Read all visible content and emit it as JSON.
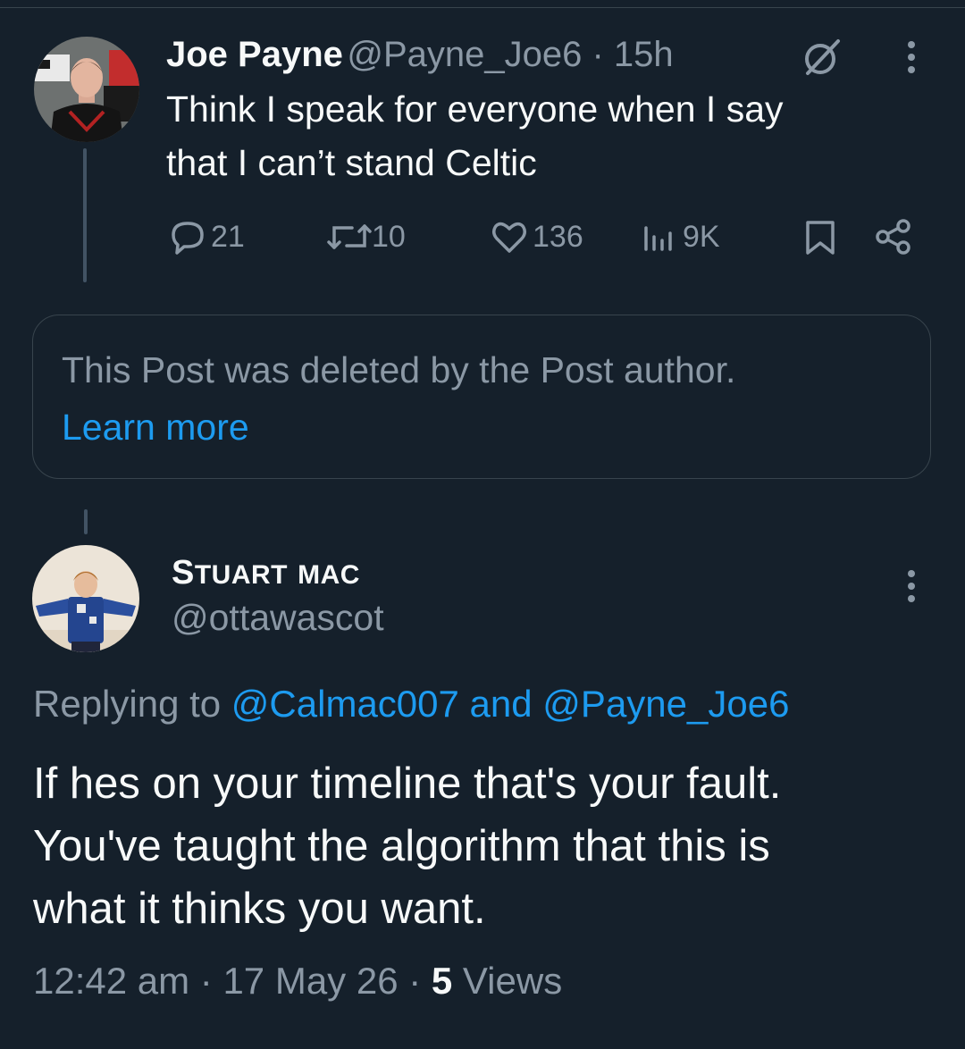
{
  "post": {
    "author_name": "Joe Payne",
    "handle": "@Payne_Joe6",
    "separator": " · ",
    "time": "15h",
    "text_line1": "Think I speak for everyone when I say",
    "text_line2": "that I can’t stand Celtic",
    "replies": "21",
    "reposts": "10",
    "likes": "136",
    "views": "9K"
  },
  "deleted_notice": {
    "text": "This Post was deleted by the Post author.",
    "link": "Learn more"
  },
  "reply": {
    "author_first": "S",
    "author_first_rest": "TUART",
    "author_last": "MAC",
    "handle": "@ottawascot",
    "replying_prefix": "Replying to ",
    "replying_user1": "@Calmac007",
    "replying_and": " and ",
    "replying_user2": "@Payne_Joe6",
    "text_line1": "If hes on your timeline that's your fault.",
    "text_line2": "You've taught the algorithm that this is",
    "text_line3": "what it thinks you want.",
    "timestamp": "12:42 am · 17 May 26 · ",
    "views_count": "5",
    "views_label": " Views"
  },
  "colors": {
    "background": "#15202b",
    "text": "#f7f9f9",
    "muted": "#8b98a5",
    "accent": "#1d9bf0",
    "border": "#38444d"
  },
  "icons": [
    "profile-photo-joe",
    "grok-icon",
    "more-icon",
    "reply-icon",
    "repost-icon",
    "like-icon",
    "views-icon",
    "bookmark-icon",
    "share-icon",
    "profile-photo-stuart"
  ]
}
